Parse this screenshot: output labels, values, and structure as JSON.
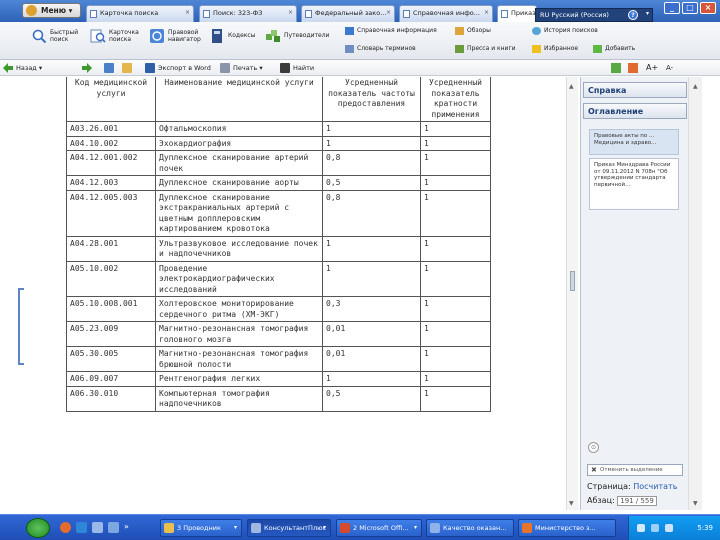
{
  "window": {
    "menu_label": "Меню",
    "tabs": [
      {
        "label": "Карточка поиска",
        "active": false
      },
      {
        "label": "Поиск: 323-ФЗ",
        "active": false
      },
      {
        "label": "Федеральный зако...",
        "active": false
      },
      {
        "label": "Справочная инфо...",
        "active": false
      },
      {
        "label": "Приказ",
        "active": true
      }
    ],
    "language": "RU Русский (Россия)",
    "help_glyph": "?",
    "minimize_glyph": "_",
    "maximize_glyph": "□",
    "close_glyph": "×"
  },
  "ribbon": {
    "quick_search": "Быстрый поиск",
    "card_search": "Карточка поиска",
    "legal_navigator": "Правовой навигатор",
    "codes": "Кодексы",
    "putevoditeli": "Путеводители",
    "reference_info": "Справочная информация",
    "dictionary": "Словарь терминов",
    "reviews": "Обзоры",
    "press_books": "Пресса и книги",
    "search_history": "История поисков",
    "favorites": "Избранное",
    "add": "Добавить"
  },
  "navbar": {
    "back": "Назад",
    "export_word": "Экспорт в Word",
    "print": "Печать",
    "notes": "Найти",
    "font_increase": "A+",
    "font_decrease": "A-"
  },
  "table": {
    "headers": [
      "Код медицинской услуги",
      "Наименование медицинской услуги",
      "Усредненный показатель частоты предоставления",
      "Усредненный показатель кратности применения"
    ],
    "rows": [
      {
        "code": "A03.26.001",
        "name": "Офтальмоскопия",
        "freq": "1",
        "mult": "1"
      },
      {
        "code": "A04.10.002",
        "name": "Эхокардиография",
        "freq": "1",
        "mult": "1"
      },
      {
        "code": "A04.12.001.002",
        "name": "Дуплексное сканирование артерий почек",
        "freq": "0,8",
        "mult": "1"
      },
      {
        "code": "A04.12.003",
        "name": "Дуплексное сканирование аорты",
        "freq": "0,5",
        "mult": "1"
      },
      {
        "code": "A04.12.005.003",
        "name": "Дуплексное сканирование экстракраниальных артерий с цветным допплеровским картированием кровотока",
        "freq": "0,8",
        "mult": "1"
      },
      {
        "code": "A04.28.001",
        "name": "Ультразвуковое исследование почек и надпочечников",
        "freq": "1",
        "mult": "1"
      },
      {
        "code": "A05.10.002",
        "name": "Проведение электрокардиографических исследований",
        "freq": "1",
        "mult": "1"
      },
      {
        "code": "A05.10.008.001",
        "name": "Холтеровское мониторирование сердечного ритма (ХМ-ЭКГ)",
        "freq": "0,3",
        "mult": "1"
      },
      {
        "code": "A05.23.009",
        "name": "Магнитно-резонансная томография головного мозга",
        "freq": "0,01",
        "mult": "1"
      },
      {
        "code": "A05.30.005",
        "name": "Магнитно-резонансная томография брюшной полости",
        "freq": "0,01",
        "mult": "1"
      },
      {
        "code": "A06.09.007",
        "name": "Рентгенография легких",
        "freq": "1",
        "mult": "1"
      },
      {
        "code": "A06.30.010",
        "name": "Компьютерная томография надпочечников",
        "freq": "0,5",
        "mult": "1"
      }
    ]
  },
  "right_pane": {
    "help_title": "Справка",
    "toc_title": "Оглавление",
    "card1": "Правовые акты по ... Медицина и здраво...",
    "card2": "Приказ Минздрава России от 09.11.2012 N 708н \"Об утверждении стандарта первичной...",
    "clear_button": "Отменить выделение",
    "page_label": "Страница:",
    "page_link": "Посчитать",
    "para_label": "Абзац:",
    "para_value": "191 / 559"
  },
  "taskbar": {
    "tasks": [
      {
        "label": "3 Проводник",
        "color": "#e8c04a",
        "active": false
      },
      {
        "label": "КонсультантПлюс",
        "color": "#9fb8e0",
        "active": true
      },
      {
        "label": "2 Microsoft Offi...",
        "color": "#d84b2a",
        "active": false
      },
      {
        "label": "Качество оказан...",
        "color": "#8fb2e8",
        "active": false
      },
      {
        "label": "Министерство з...",
        "color": "#e8742a",
        "active": false
      }
    ],
    "clock": "5:39"
  },
  "colors": {
    "titlebar": "#2d62b8",
    "taskbar": "#1f4fb6",
    "start": "#1f8a1f",
    "link": "#2a5db0"
  }
}
